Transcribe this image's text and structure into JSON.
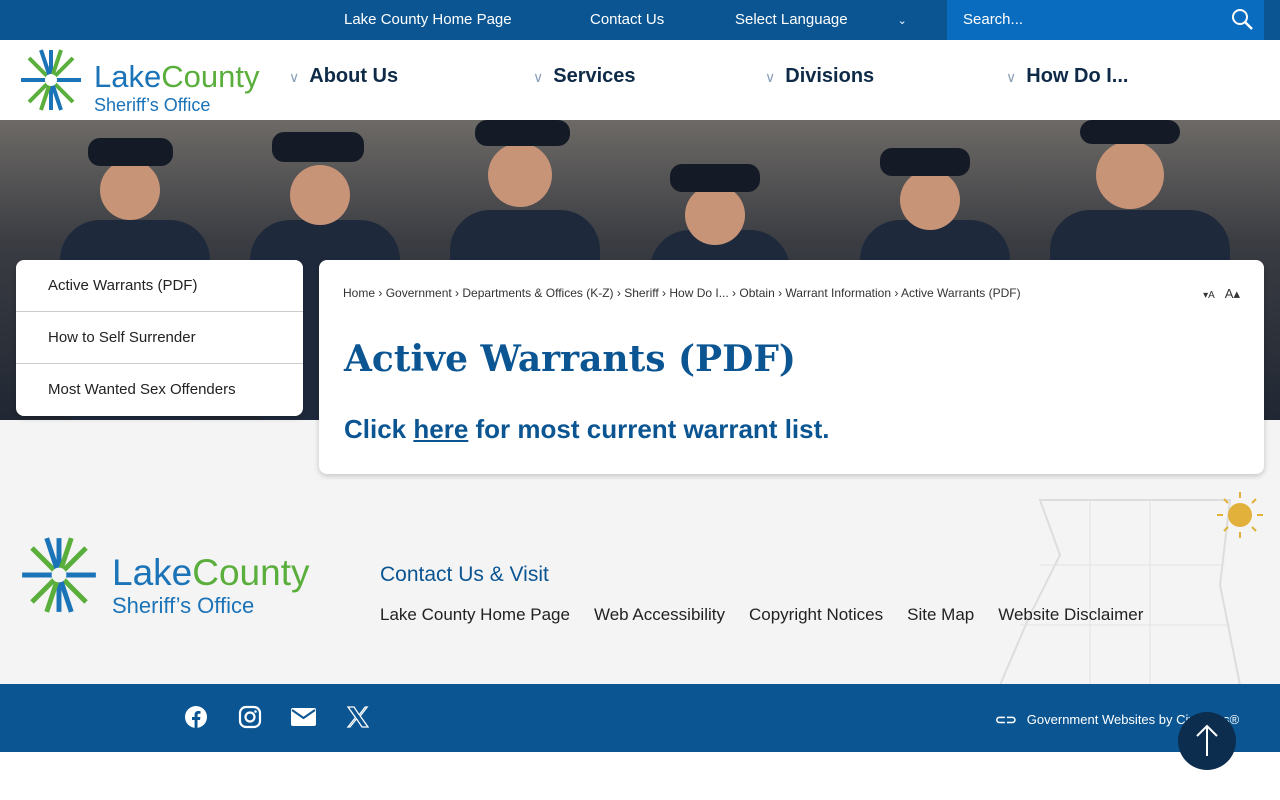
{
  "topbar": {
    "home": "Lake County Home Page",
    "contact": "Contact Us",
    "language": "Select Language",
    "search_placeholder": "Search..."
  },
  "logo": {
    "line1a": "Lake",
    "line1b": "County",
    "line2": "Sheriff’s Office"
  },
  "nav": [
    {
      "label": "About Us"
    },
    {
      "label": "Services"
    },
    {
      "label": "Divisions"
    },
    {
      "label": "How Do I..."
    }
  ],
  "sidebar": [
    {
      "label": "Active Warrants (PDF)"
    },
    {
      "label": "How to Self Surrender"
    },
    {
      "label": "Most Wanted Sex Offenders"
    }
  ],
  "breadcrumb": [
    "Home",
    "Government",
    "Departments & Offices (K-Z)",
    "Sheriff",
    "How Do I...",
    "Obtain",
    "Warrant Information",
    "Active Warrants (PDF)"
  ],
  "font_size": {
    "decrease": "▾A",
    "increase": "A▴"
  },
  "page": {
    "title": "Active Warrants (PDF)",
    "text_before": "Click ",
    "link": "here",
    "text_after": " for most current warrant list."
  },
  "footer": {
    "heading": "Contact Us & Visit",
    "links": [
      "Lake County Home Page",
      "Web Accessibility",
      "Copyright Notices",
      "Site Map",
      "Website Disclaimer"
    ],
    "credit": "Government Websites by CivicPlus®"
  },
  "colors": {
    "primary": "#0b5592",
    "green": "#5aae3c",
    "search": "#0a6cbe"
  }
}
